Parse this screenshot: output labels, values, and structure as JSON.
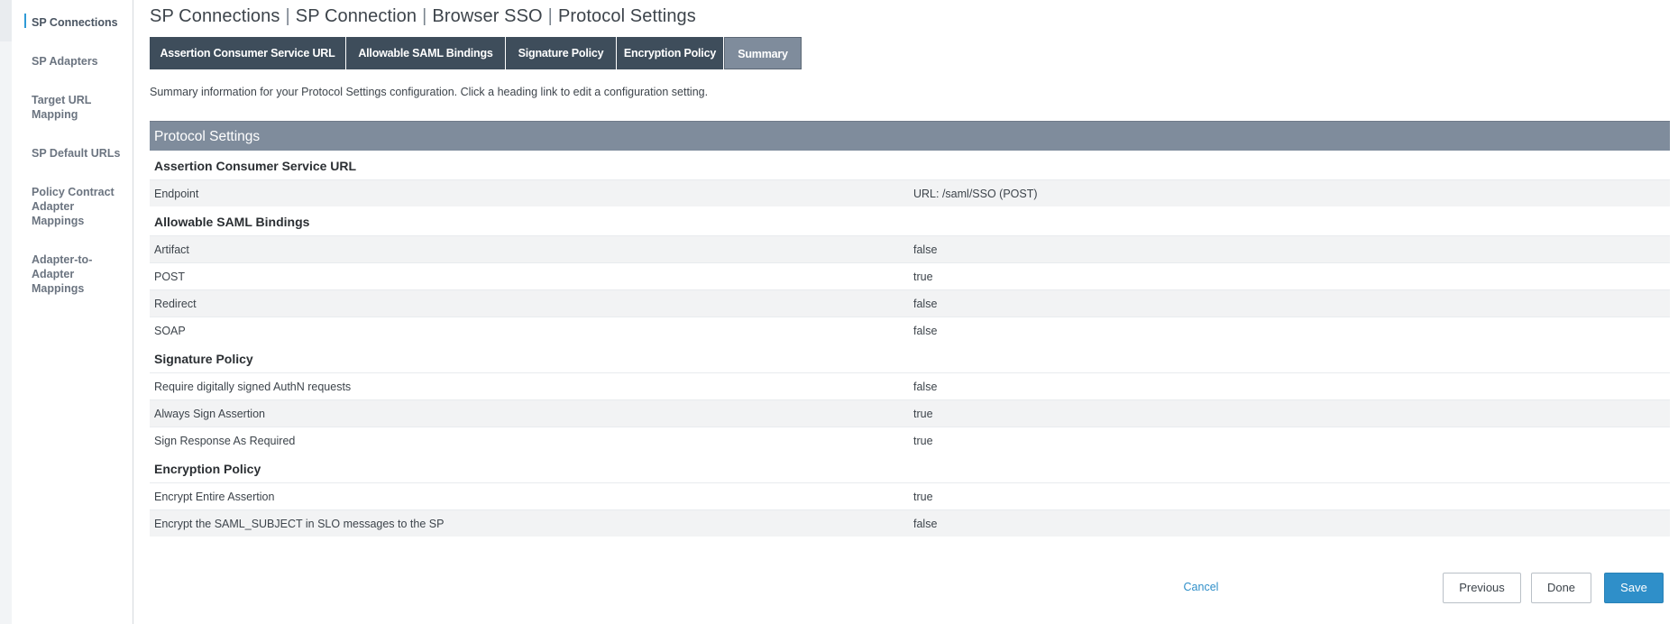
{
  "sidebar": {
    "items": [
      {
        "label": "SP Connections",
        "active": true
      },
      {
        "label": "SP Adapters"
      },
      {
        "label": "Target URL Mapping"
      },
      {
        "label": "SP Default URLs"
      },
      {
        "label": "Policy Contract Adapter Mappings"
      },
      {
        "label": "Adapter-to-Adapter Mappings"
      }
    ]
  },
  "breadcrumb": [
    "SP Connections",
    "SP Connection",
    "Browser SSO",
    "Protocol Settings"
  ],
  "tabs": [
    {
      "label": "Assertion Consumer Service URL"
    },
    {
      "label": "Allowable SAML Bindings"
    },
    {
      "label": "Signature Policy"
    },
    {
      "label": "Encryption Policy"
    },
    {
      "label": "Summary",
      "active": true
    }
  ],
  "description": "Summary information for your Protocol Settings configuration. Click a heading link to edit a configuration setting.",
  "panel_title": "Protocol Settings",
  "sections": [
    {
      "title": "Assertion Consumer Service URL",
      "rows": [
        {
          "label": "Endpoint",
          "value": "URL: /saml/SSO (POST)"
        }
      ]
    },
    {
      "title": "Allowable SAML Bindings",
      "rows": [
        {
          "label": "Artifact",
          "value": "false"
        },
        {
          "label": "POST",
          "value": "true"
        },
        {
          "label": "Redirect",
          "value": "false"
        },
        {
          "label": "SOAP",
          "value": "false"
        }
      ]
    },
    {
      "title": "Signature Policy",
      "rows": [
        {
          "label": "Require digitally signed AuthN requests",
          "value": "false"
        },
        {
          "label": "Always Sign Assertion",
          "value": "true"
        },
        {
          "label": "Sign Response As Required",
          "value": "true"
        }
      ]
    },
    {
      "title": "Encryption Policy",
      "rows": [
        {
          "label": "Encrypt Entire Assertion",
          "value": "true"
        },
        {
          "label": "Encrypt the SAML_SUBJECT in SLO messages to the SP",
          "value": "false"
        }
      ]
    }
  ],
  "actions": {
    "cancel": "Cancel",
    "previous": "Previous",
    "done": "Done",
    "save": "Save"
  },
  "colors": {
    "tab": "#3e4d5b",
    "tab_active": "#7f8c9c",
    "panel_header": "#7f8c9c",
    "accent": "#2f8fc9"
  }
}
